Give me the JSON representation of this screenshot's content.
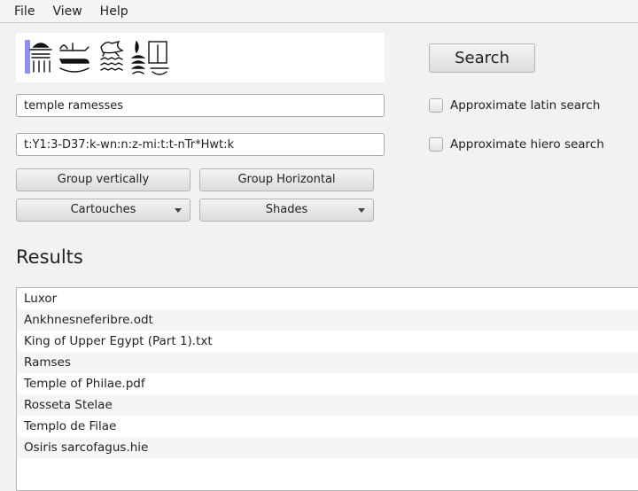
{
  "menu": [
    "File",
    "View",
    "Help"
  ],
  "search": {
    "latin_value": "temple ramesses",
    "hiero_value": "t:Y1:3-D37:k-wn:n:z-mi:t:t-nTr*Hwt:k",
    "button_label": "Search"
  },
  "options": {
    "approx_latin": "Approximate latin search",
    "approx_hiero": "Approximate hiero search"
  },
  "toolbar": {
    "group_vertically": "Group vertically",
    "group_horizontal": "Group Horizontal",
    "cartouches": "Cartouches",
    "shades": "Shades"
  },
  "results": {
    "title": "Results",
    "items": [
      "Luxor",
      "Ankhnesneferibre.odt",
      "King of Upper Egypt (Part 1).txt",
      "Ramses",
      "Temple of Philae.pdf",
      "Rosseta Stelae",
      "Templo de Filae",
      "Osiris sarcofagus.hie"
    ]
  },
  "colors": {
    "caret": "#8f8ff0",
    "background": "#f2f2f2"
  }
}
